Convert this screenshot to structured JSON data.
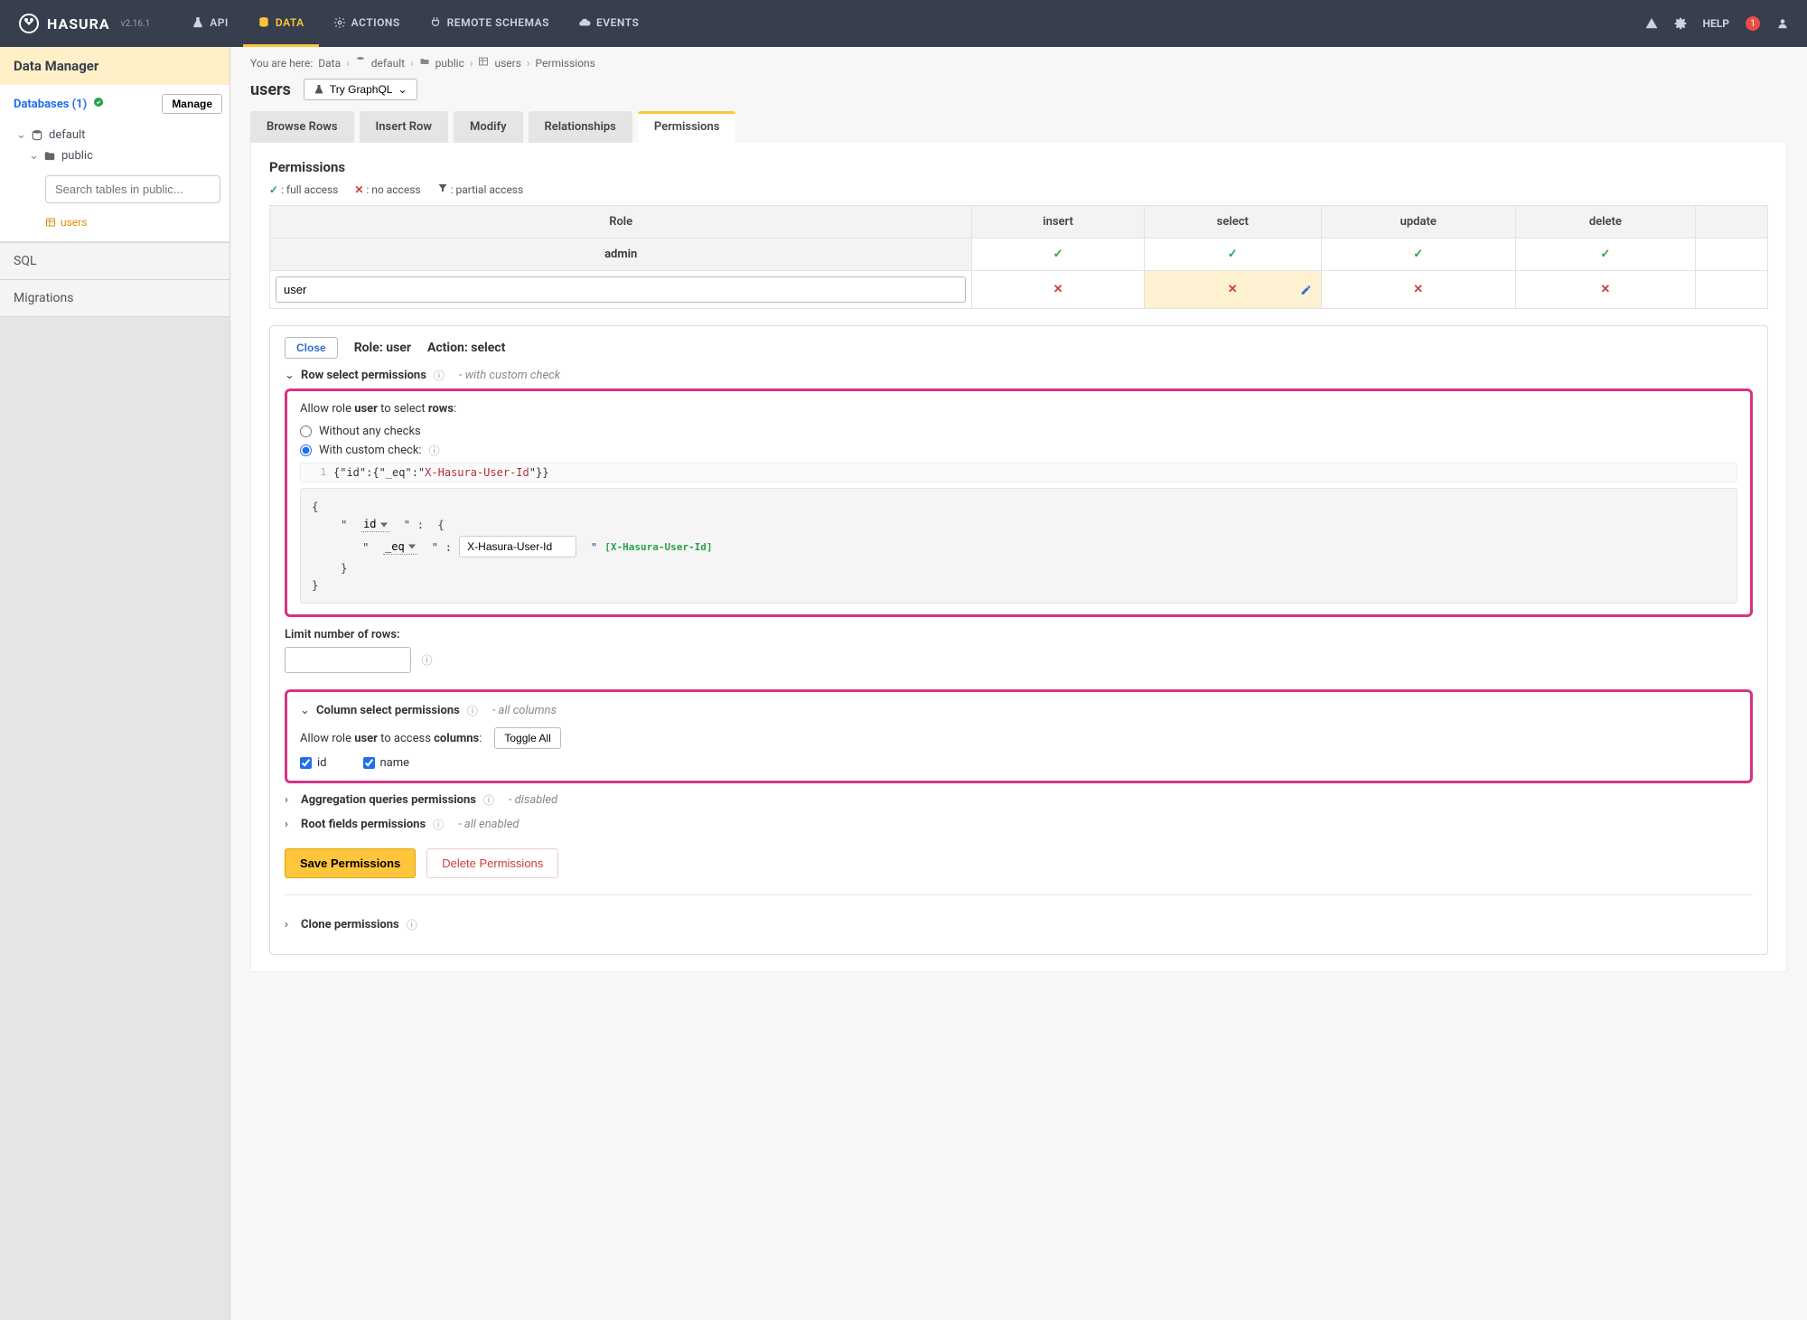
{
  "brand": {
    "name": "HASURA",
    "version": "v2.16.1"
  },
  "nav": {
    "api": "API",
    "data": "DATA",
    "actions": "ACTIONS",
    "remote": "REMOTE SCHEMAS",
    "events": "EVENTS",
    "help": "HELP",
    "notif_count": "1"
  },
  "sidebar": {
    "title": "Data Manager",
    "dbs_label": "Databases (1)",
    "manage": "Manage",
    "default": "default",
    "schema": "public",
    "search_ph": "Search tables in public...",
    "table": "users",
    "sql": "SQL",
    "migrations": "Migrations"
  },
  "breadcrumb": {
    "prefix": "You are here:",
    "data": "Data",
    "db": "default",
    "schema": "public",
    "table": "users",
    "page": "Permissions"
  },
  "header": {
    "title": "users",
    "try": "Try GraphQL"
  },
  "tabs": {
    "browse": "Browse Rows",
    "insert": "Insert Row",
    "modify": "Modify",
    "rel": "Relationships",
    "perm": "Permissions"
  },
  "perm": {
    "title": "Permissions",
    "legend_full": ": full access",
    "legend_none": ": no access",
    "legend_partial": ": partial access",
    "cols": {
      "role": "Role",
      "insert": "insert",
      "select": "select",
      "update": "update",
      "delete": "delete"
    },
    "rows": {
      "admin": "admin",
      "user": "user"
    },
    "panel": {
      "close": "Close",
      "role_lbl": "Role: user",
      "action_lbl": "Action: select",
      "row_hdr": "Row select permissions",
      "row_hint": "- with custom check",
      "allow_pre": "Allow role ",
      "allow_role": "user",
      "allow_mid": " to select ",
      "allow_rows": "rows",
      "opt_without": "Without any checks",
      "opt_with": "With custom check:",
      "code_json_a": "{\"id\":{\"_eq\":\"",
      "code_json_b": "X-Hasura-User-Id",
      "code_json_c": "\"}}",
      "builder": {
        "field": "id",
        "op": "_eq",
        "val": "X-Hasura-User-Id",
        "session": "[X-Hasura-User-Id]"
      },
      "limit_lbl": "Limit number of rows:",
      "col_hdr": "Column select permissions",
      "col_hint": "- all columns",
      "col_allow_pre": "Allow role ",
      "col_allow_role": "user",
      "col_allow_mid": " to access ",
      "col_allow_cols": "columns",
      "toggle": "Toggle All",
      "col_id": "id",
      "col_name": "name",
      "agg_hdr": "Aggregation queries permissions",
      "agg_hint": "- disabled",
      "root_hdr": "Root fields permissions",
      "root_hint": "- all enabled",
      "save": "Save Permissions",
      "delete": "Delete Permissions",
      "clone": "Clone permissions"
    }
  }
}
